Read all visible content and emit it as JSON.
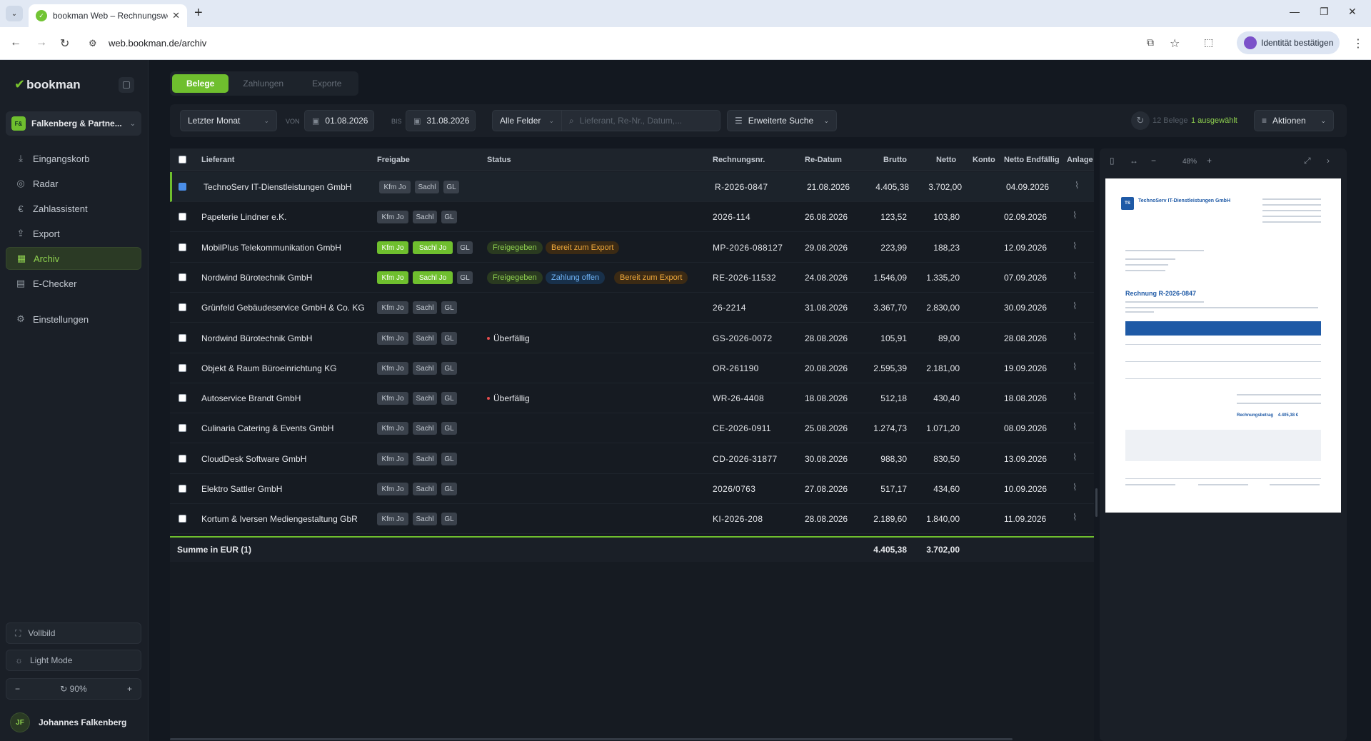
{
  "browser": {
    "tab_title": "bookman Web – Rechnungsworkfl",
    "url": "web.bookman.de/archiv",
    "identity": "Identität bestätigen"
  },
  "sidebar": {
    "logo": "bookman",
    "company_badge": "F&",
    "company": "Falkenberg & Partne...",
    "items": [
      "Eingangskorb",
      "Radar",
      "Zahlassistent",
      "Export",
      "Archiv",
      "E-Checker",
      "Einstellungen"
    ],
    "fullscreen": "Vollbild",
    "light_mode": "Light Mode",
    "zoom": "90%",
    "user_initials": "JF",
    "user_name": "Johannes Falkenberg"
  },
  "tabs": [
    "Belege",
    "Zahlungen",
    "Exporte"
  ],
  "filters": {
    "period": "Letzter Monat",
    "von": "VON",
    "date_from": "01.08.2026",
    "bis": "BIS",
    "date_to": "31.08.2026",
    "fields": "Alle Felder",
    "search_placeholder": "Lieferant, Re-Nr., Datum,...",
    "advanced": "Erweiterte Suche",
    "count": "12 Belege",
    "selected": "1 ausgewählt",
    "actions": "Aktionen"
  },
  "table": {
    "headers": [
      "Lieferant",
      "Freigabe",
      "Status",
      "Rechnungsnr.",
      "Re-Datum",
      "Brutto",
      "Netto",
      "Konto",
      "Netto Endfällig",
      "Anlage"
    ],
    "rows": [
      {
        "supplier": "TechnoServ IT-Dienstleistungen GmbH",
        "kfm": "Kfm Jo",
        "sachl": "Sachl",
        "gl": "GL",
        "approved": false,
        "status": [],
        "invoice": "R-2026-0847",
        "date": "21.08.2026",
        "gross": "4.405,38",
        "net": "3.702,00",
        "due": "04.09.2026",
        "selected": true
      },
      {
        "supplier": "Papeterie Lindner e.K.",
        "kfm": "Kfm Jo",
        "sachl": "Sachl",
        "gl": "GL",
        "approved": false,
        "status": [],
        "invoice": "2026-114",
        "date": "26.08.2026",
        "gross": "123,52",
        "net": "103,80",
        "due": "02.09.2026",
        "selected": false
      },
      {
        "supplier": "MobilPlus Telekommunikation GmbH",
        "kfm": "Kfm Jo",
        "sachl": "Sachl Jo",
        "gl": "GL",
        "approved": true,
        "status": [
          "Freigegeben",
          "Bereit zum Export"
        ],
        "invoice": "MP-2026-088127",
        "date": "29.08.2026",
        "gross": "223,99",
        "net": "188,23",
        "due": "12.09.2026",
        "selected": false
      },
      {
        "supplier": "Nordwind Bürotechnik GmbH",
        "kfm": "Kfm Jo",
        "sachl": "Sachl Jo",
        "gl": "GL",
        "approved": true,
        "status": [
          "Freigegeben",
          "Zahlung offen",
          "Bereit zum Export"
        ],
        "invoice": "RE-2026-11532",
        "date": "24.08.2026",
        "gross": "1.546,09",
        "net": "1.335,20",
        "due": "07.09.2026",
        "selected": false
      },
      {
        "supplier": "Grünfeld Gebäudeservice GmbH & Co. KG",
        "kfm": "Kfm Jo",
        "sachl": "Sachl",
        "gl": "GL",
        "approved": false,
        "status": [],
        "invoice": "26-2214",
        "date": "31.08.2026",
        "gross": "3.367,70",
        "net": "2.830,00",
        "due": "30.09.2026",
        "selected": false
      },
      {
        "supplier": "Nordwind Bürotechnik GmbH",
        "kfm": "Kfm Jo",
        "sachl": "Sachl",
        "gl": "GL",
        "approved": false,
        "status": [
          "Überfällig"
        ],
        "invoice": "GS-2026-0072",
        "date": "28.08.2026",
        "gross": "105,91",
        "net": "89,00",
        "due": "28.08.2026",
        "selected": false
      },
      {
        "supplier": "Objekt & Raum Büroeinrichtung KG",
        "kfm": "Kfm Jo",
        "sachl": "Sachl",
        "gl": "GL",
        "approved": false,
        "status": [],
        "invoice": "OR-261190",
        "date": "20.08.2026",
        "gross": "2.595,39",
        "net": "2.181,00",
        "due": "19.09.2026",
        "selected": false
      },
      {
        "supplier": "Autoservice Brandt GmbH",
        "kfm": "Kfm Jo",
        "sachl": "Sachl",
        "gl": "GL",
        "approved": false,
        "status": [
          "Überfällig"
        ],
        "invoice": "WR-26-4408",
        "date": "18.08.2026",
        "gross": "512,18",
        "net": "430,40",
        "due": "18.08.2026",
        "selected": false
      },
      {
        "supplier": "Culinaria Catering & Events GmbH",
        "kfm": "Kfm Jo",
        "sachl": "Sachl",
        "gl": "GL",
        "approved": false,
        "status": [],
        "invoice": "CE-2026-0911",
        "date": "25.08.2026",
        "gross": "1.274,73",
        "net": "1.071,20",
        "due": "08.09.2026",
        "selected": false
      },
      {
        "supplier": "CloudDesk Software GmbH",
        "kfm": "Kfm Jo",
        "sachl": "Sachl",
        "gl": "GL",
        "approved": false,
        "status": [],
        "invoice": "CD-2026-31877",
        "date": "30.08.2026",
        "gross": "988,30",
        "net": "830,50",
        "due": "13.09.2026",
        "selected": false
      },
      {
        "supplier": "Elektro Sattler GmbH",
        "kfm": "Kfm Jo",
        "sachl": "Sachl",
        "gl": "GL",
        "approved": false,
        "status": [],
        "invoice": "2026/0763",
        "date": "27.08.2026",
        "gross": "517,17",
        "net": "434,60",
        "due": "10.09.2026",
        "selected": false
      },
      {
        "supplier": "Kortum & Iversen Mediengestaltung GbR",
        "kfm": "Kfm Jo",
        "sachl": "Sachl",
        "gl": "GL",
        "approved": false,
        "status": [],
        "invoice": "KI-2026-208",
        "date": "28.08.2026",
        "gross": "2.189,60",
        "net": "1.840,00",
        "due": "11.09.2026",
        "selected": false
      }
    ],
    "sum": {
      "label": "Summe in EUR (1)",
      "gross": "4.405,38",
      "net": "3.702,00"
    }
  },
  "preview": {
    "zoom": "48%",
    "logo": "TS",
    "company": "TechnoServ IT-Dienstleistungen GmbH",
    "title": "Rechnung R-2026-0847",
    "total_label": "Rechnungsbetrag",
    "total": "4.405,38 €"
  },
  "colors": {
    "accent": "#6fbf2e",
    "background": "#131820",
    "sidebar": "#1a1f27"
  }
}
